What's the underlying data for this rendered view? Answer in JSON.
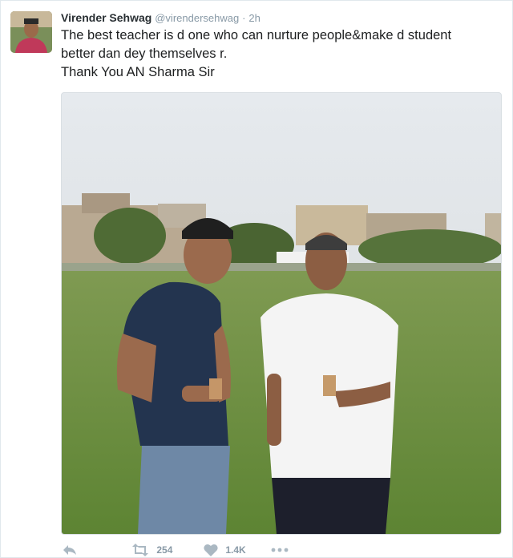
{
  "tweet": {
    "author_name": "Virender Sehwag",
    "handle": "@virendersehwag",
    "separator": "·",
    "time": "2h",
    "text_lines": [
      "The best teacher is d one who can nurture people&make d student",
      "better dan dey themselves r.",
      "Thank You AN Sharma Sir"
    ]
  },
  "actions": {
    "reply": {
      "icon": "reply-icon"
    },
    "retweet": {
      "icon": "retweet-icon",
      "count": "254"
    },
    "like": {
      "icon": "heart-icon",
      "count": "1.4K"
    },
    "more": {
      "icon": "more-icon"
    }
  },
  "colors": {
    "text": "#292f33",
    "meta": "#8899a6",
    "border": "#e1e8ed",
    "grass": "#6b8f3c",
    "sky": "#e8ecef"
  }
}
